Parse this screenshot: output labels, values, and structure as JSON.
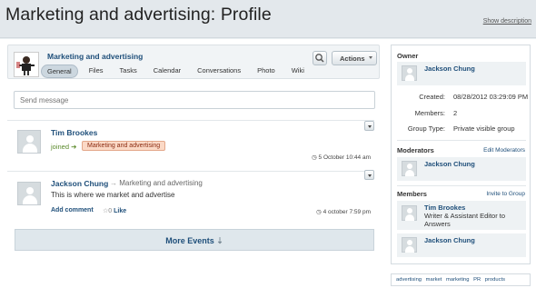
{
  "page": {
    "title": "Marketing and advertising: Profile",
    "show_description": "Show description"
  },
  "group": {
    "name": "Marketing and advertising",
    "tabs": [
      "General",
      "Files",
      "Tasks",
      "Calendar",
      "Conversations",
      "Photo",
      "Wiki"
    ],
    "active_tab": "General",
    "actions_label": "Actions"
  },
  "composer": {
    "placeholder": "Send message"
  },
  "feed": [
    {
      "author": "Tim Brookes",
      "action": "joined",
      "target_badge": "Marketing and advertising",
      "time": "5 October 10:44 am"
    },
    {
      "author": "Jackson Chung",
      "target": "Marketing and advertising",
      "message": "This is where we market and advertise",
      "add_comment": "Add comment",
      "like_count": "0",
      "like_label": "Like",
      "time": "4 october 7:59 pm"
    }
  ],
  "more_events": "More Events",
  "sidebar": {
    "owner": {
      "heading": "Owner",
      "name": "Jackson Chung"
    },
    "info": {
      "created_label": "Created:",
      "created_value": "08/28/2012 03:29:09 PM",
      "members_label": "Members:",
      "members_value": "2",
      "group_type_label": "Group Type:",
      "group_type_value": "Private visible group"
    },
    "moderators": {
      "heading": "Moderators",
      "link": "Edit Moderators",
      "people": [
        {
          "name": "Jackson Chung"
        }
      ]
    },
    "members": {
      "heading": "Members",
      "link": "Invite to Group",
      "people": [
        {
          "name": "Tim Brookes",
          "subtitle": "Writer & Assistant Editor to Answers"
        },
        {
          "name": "Jackson Chung"
        }
      ]
    }
  },
  "tags": [
    "advertising",
    "market",
    "marketing",
    "PR",
    "products"
  ]
}
